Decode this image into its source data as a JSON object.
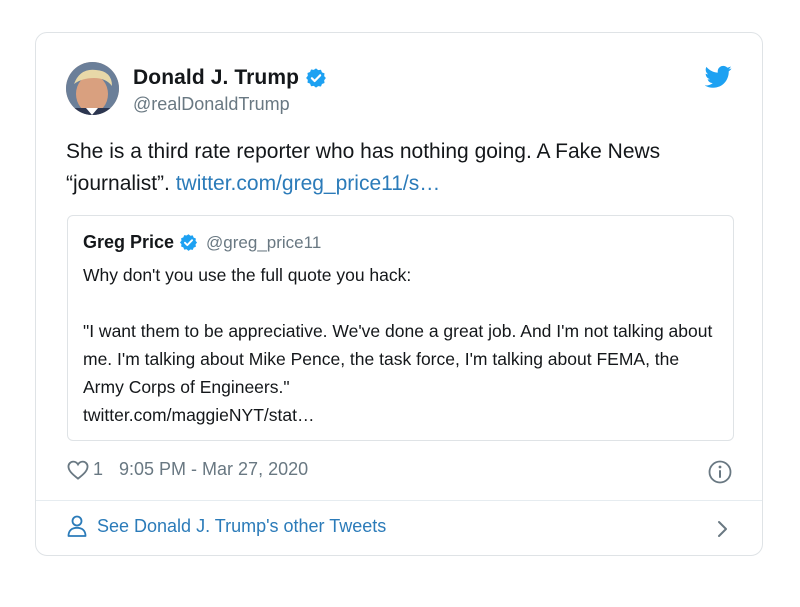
{
  "tweet": {
    "author_name": "Donald J. Trump",
    "author_handle": "@realDonaldTrump",
    "text": "She is a third rate reporter who has nothing going. A Fake News “journalist”. ",
    "link_text": "twitter.com/greg_price11/s…",
    "likes": "1",
    "timestamp": "9:05 PM - Mar 27, 2020"
  },
  "quote": {
    "author_name": "Greg Price",
    "author_handle": "@greg_price11",
    "line1": "Why don't you use the full quote you hack:",
    "line2": "\"I want them to be appreciative. We've done a great job. And I'm not talking about me. I'm talking about Mike Pence, the task force, I'm talking about FEMA, the Army Corps of Engineers.\"",
    "link_text": "twitter.com/maggieNYT/stat…"
  },
  "footer": {
    "label": "See Donald J. Trump's other Tweets"
  },
  "icons": {
    "verified": "verified-badge-icon",
    "twitter": "twitter-bird-icon",
    "like": "heart-icon",
    "info": "info-icon",
    "profile": "person-icon",
    "more": "chevron-right-icon"
  },
  "colors": {
    "brand_blue": "#1da1f2",
    "link_blue": "#2b7bb9",
    "text": "#14171a",
    "muted": "#697882",
    "border": "#dfe3e6"
  }
}
